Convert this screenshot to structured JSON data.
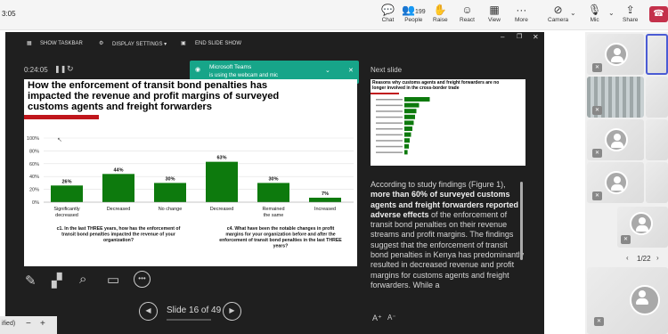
{
  "topbar": {
    "time": "3:05",
    "count": "199",
    "buttons": [
      {
        "label": "Chat",
        "icon": "chat-icon"
      },
      {
        "label": "People",
        "icon": "people-icon"
      },
      {
        "label": "Raise",
        "icon": "hand-icon"
      },
      {
        "label": "React",
        "icon": "smile-icon"
      },
      {
        "label": "View",
        "icon": "grid-icon"
      },
      {
        "label": "More",
        "icon": "more-icon"
      },
      {
        "label": "Camera",
        "icon": "camera-icon"
      },
      {
        "label": "Mic",
        "icon": "mic-icon"
      },
      {
        "label": "Share",
        "icon": "share-icon"
      }
    ],
    "leave_color": "#c4314b"
  },
  "presenter": {
    "show_taskbar": "SHOW TASKBAR",
    "display_settings": "DISPLAY SETTINGS ▾",
    "end_slide_show": "END SLIDE SHOW",
    "timer": "0:24:05",
    "slide_counter": "Slide 16 of 49",
    "next_slide_label": "Next slide"
  },
  "toast": {
    "title": "Microsoft Teams",
    "body": "is using the webcam and mic",
    "color": "#17a589"
  },
  "slide": {
    "title": "How the enforcement of transit bond penalties has impacted the revenue and profit margins of surveyed customs agents and freight forwarders",
    "accent": "#c0161c"
  },
  "chart_data": [
    {
      "type": "bar",
      "categories": [
        "Significantly decreased",
        "Decreased",
        "No change"
      ],
      "values": [
        26,
        44,
        30
      ],
      "labels": [
        "26%",
        "44%",
        "30%"
      ],
      "xlabel": "c1. In the last THREE years, how has the enforcement of transit bond penalties impacted the revenue of your organization?",
      "ylim": [
        0,
        100
      ],
      "yticks": [
        "100%",
        "80%",
        "60%",
        "40%",
        "20%",
        "0%"
      ],
      "bar_color": "#0d7a0d",
      "grid": true
    },
    {
      "type": "bar",
      "categories": [
        "Decreased",
        "Remained the same",
        "Increased"
      ],
      "values": [
        63,
        30,
        7
      ],
      "labels": [
        "63%",
        "30%",
        "7%"
      ],
      "xlabel": "c4. What have been the notable changes in profit margins for your organization before and after the enforcement of transit bond penalties in the last THREE years?",
      "ylim": [
        0,
        100
      ],
      "bar_color": "#0d7a0d"
    }
  ],
  "next_slide": {
    "title": "Reasons why customs agents and freight forwarders are no longer involved in the cross-border trade",
    "bars": [
      0.95,
      0.55,
      0.45,
      0.4,
      0.35,
      0.3,
      0.25,
      0.2,
      0.17,
      0.12
    ]
  },
  "notes": {
    "pre": "According to study findings (Figure 1), ",
    "bold": "more than 60% of surveyed customs agents and freight forwarders reported adverse effects",
    "post": " of the enforcement of transit bond penalties on their revenue streams and profit margins. The findings suggest that the enforcement of transit bond penalties in Kenya has predominantly resulted in decreased revenue and profit margins for customs agents and freight forwarders. While a"
  },
  "panel": {
    "page": "1/22"
  },
  "bottom": {
    "zoom_label": "ified)",
    "minus": "−",
    "plus": "+"
  }
}
